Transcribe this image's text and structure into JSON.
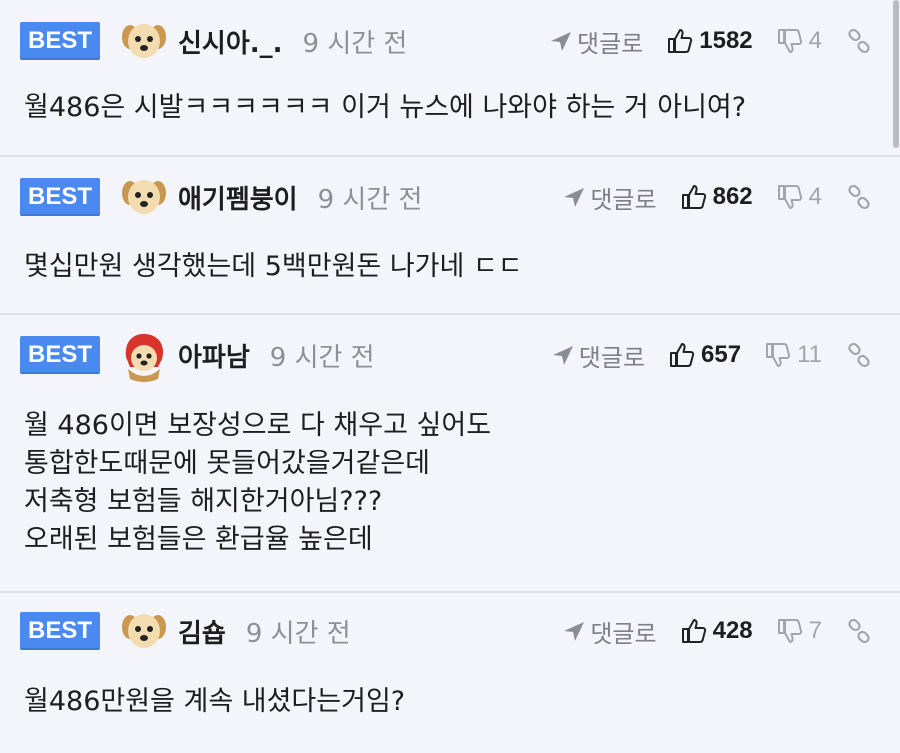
{
  "comments": [
    {
      "badge": "BEST",
      "nickname": "신시아._.",
      "time": "9 시간 전",
      "reply_label": "댓글로",
      "upvotes": "1582",
      "downvotes": "4",
      "text": "월486은 시발ㅋㅋㅋㅋㅋㅋ 이거 뉴스에 나와야 하는 거 아니여?"
    },
    {
      "badge": "BEST",
      "nickname": "애기펨붕이",
      "time": "9 시간 전",
      "reply_label": "댓글로",
      "upvotes": "862",
      "downvotes": "4",
      "text": "몇십만원 생각했는데 5백만원돈 나가네 ㄷㄷ"
    },
    {
      "badge": "BEST",
      "nickname": "아파남",
      "time": "9 시간 전",
      "reply_label": "댓글로",
      "upvotes": "657",
      "downvotes": "11",
      "text": "월 486이면 보장성으로 다 채우고 싶어도\n통합한도때문에 못들어갔을거같은데\n저축형 보험들 해지한거아님???\n오래된 보험들은 환급율 높은데"
    },
    {
      "badge": "BEST",
      "nickname": "김숍",
      "time": "9 시간 전",
      "reply_label": "댓글로",
      "upvotes": "428",
      "downvotes": "7",
      "text": "월486만원을 계속 내셨다는거임?"
    }
  ],
  "colors": {
    "badge_bg": "#4a8af0",
    "page_bg": "#f4f5fa",
    "text": "#1e1e1e",
    "muted": "#8e9096"
  }
}
